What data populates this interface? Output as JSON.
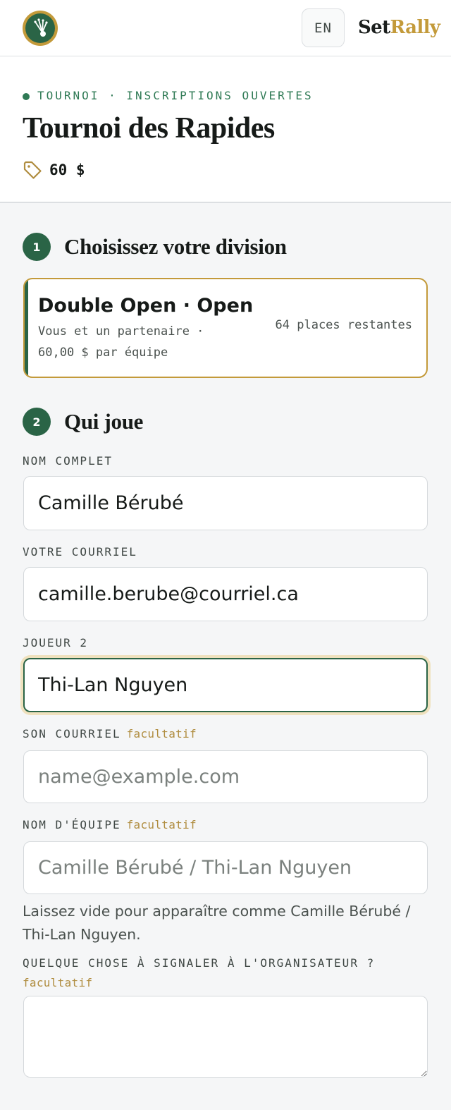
{
  "header": {
    "logo_icon": "shuttlecock-icon",
    "lang_button": "EN",
    "brand_part1": "Set",
    "brand_part2": "Rally",
    "colors": {
      "brand_green": "#2a6446",
      "brand_gold": "#c39a3a"
    }
  },
  "hero": {
    "eyebrow": "TOURNOI · INSCRIPTIONS OUVERTES",
    "title": "Tournoi des Rapides",
    "price_icon": "price-tag-icon",
    "price": "60 $"
  },
  "step1": {
    "number": "1",
    "label": "Choisissez votre division",
    "division": {
      "name": "Double Open · Open",
      "description": "Vous et un partenaire · 60,00 $ par équipe",
      "places": "64 places restantes",
      "selected": true
    }
  },
  "step2": {
    "number": "2",
    "label": "Qui joue",
    "full_name": {
      "label": "NOM COMPLET",
      "value": "Camille Bérubé"
    },
    "email": {
      "label": "VOTRE COURRIEL",
      "value": "camille.berube@courriel.ca"
    },
    "player2": {
      "label": "JOUEUR 2",
      "value": "Thi-Lan Nguyen"
    },
    "player2_email": {
      "label": "SON COURRIEL",
      "optional": "facultatif",
      "placeholder": "name@example.com",
      "value": ""
    },
    "team_name": {
      "label": "NOM D'ÉQUIPE",
      "optional": "facultatif",
      "placeholder": "Camille Bérubé / Thi-Lan Nguyen",
      "value": "",
      "hint": "Laissez vide pour apparaître comme Camille Bérubé / Thi-Lan Nguyen."
    },
    "notes": {
      "label": "QUELQUE CHOSE À SIGNALER À L'ORGANISATEUR ?",
      "optional": "facultatif",
      "value": ""
    }
  }
}
